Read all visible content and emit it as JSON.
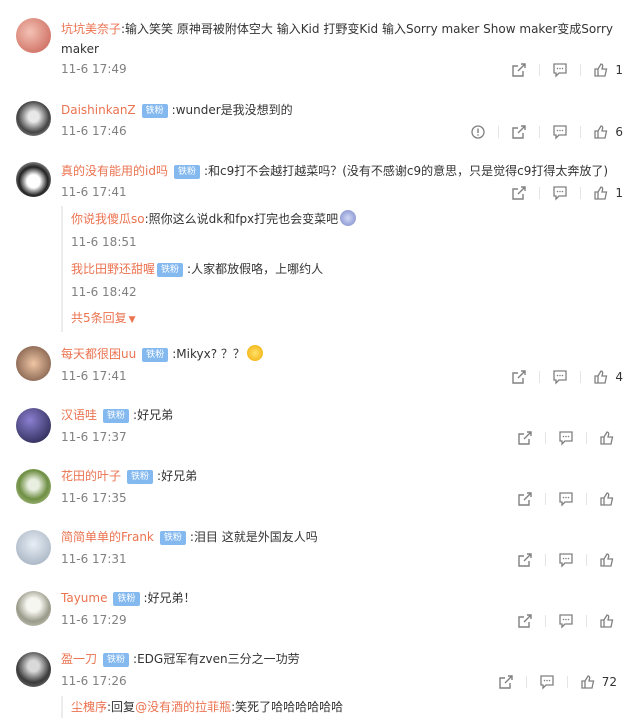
{
  "comments": [
    {
      "user": "坑坑美奈子",
      "text": ":输入笑笑 原神哥被附体空大 输入Kid 打野变Kid 输入Sorry maker Show maker变成Sorry maker",
      "time": "11-6 17:49",
      "likes": "1"
    },
    {
      "user": "DaishinkanZ",
      "badge": "铁粉",
      "text": ":wunder是我没想到的",
      "time": "11-6 17:46",
      "likes": "6"
    },
    {
      "user": "真的没有能用的id吗",
      "badge": "铁粉",
      "text": ":和c9打不会越打越菜吗？(没有不感谢c9的意思，只是觉得c9打得太奔放了)",
      "time": "11-6 17:41",
      "likes": "1",
      "replies": [
        {
          "user": "你说我傻瓜so",
          "text": ":照你这么说dk和fpx打完也会变菜吧",
          "time": "11-6 18:51"
        },
        {
          "user": "我比田野还甜喔",
          "badge": "铁粉",
          "text": ":人家都放假咯，上哪约人",
          "time": "11-6 18:42"
        }
      ],
      "more": "共5条回复"
    },
    {
      "user": "每天都很困uu",
      "badge": "铁粉",
      "text": ":Mikyx? ？？",
      "time": "11-6 17:41",
      "likes": "4"
    },
    {
      "user": "汉语哇",
      "badge": "铁粉",
      "text": ":好兄弟",
      "time": "11-6 17:37",
      "likes": ""
    },
    {
      "user": "花田的叶子",
      "badge": "铁粉",
      "text": ":好兄弟",
      "time": "11-6 17:35",
      "likes": ""
    },
    {
      "user": "简简单单的Frank",
      "badge": "铁粉",
      "text": ":泪目 这就是外国友人吗",
      "time": "11-6 17:31",
      "likes": ""
    },
    {
      "user": "Tayume",
      "badge": "铁粉",
      "text": ":好兄弟！",
      "time": "11-6 17:29",
      "likes": ""
    },
    {
      "user": "盈一刀",
      "badge": "铁粉",
      "text": ":EDG冠军有zven三分之一功劳",
      "time": "11-6 17:26",
      "likes": "72",
      "replies": [
        {
          "user": "尘槐序",
          "text": ":回复",
          "mention": "@没有酒的拉菲瓶",
          "text2": ":笑死了哈哈哈哈哈哈"
        }
      ]
    }
  ],
  "colors": {
    "username": "#eb7350",
    "badge": "#84b9f0",
    "time": "#808080"
  }
}
